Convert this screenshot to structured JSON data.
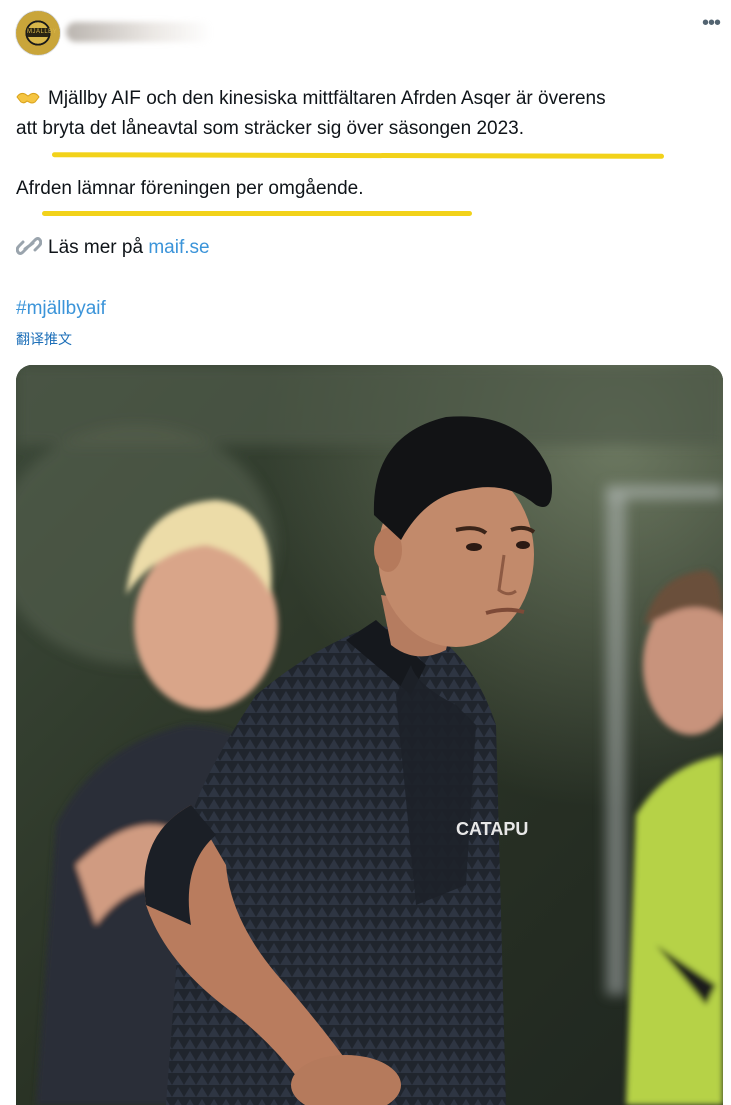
{
  "tweet": {
    "avatar_text": "MJÄLLBY",
    "paragraph1_line1": "Mjällby AIF och den kinesiska mittfältaren Afrden Asqer är överens",
    "paragraph1_line2": "att bryta det låneavtal som sträcker sig över säsongen 2023.",
    "paragraph2": "Afrden lämnar föreningen per omgående.",
    "read_more_prefix": "Läs mer på",
    "read_more_link": "maif.se",
    "hashtag": "#mjällbyaif",
    "translate_label": "翻译推文",
    "more_icon": "more-horizontal-icon",
    "emoji_icon": "handshake-icon",
    "link_icon": "chain-link-icon",
    "jersey_text": "CATAPU"
  },
  "colors": {
    "link": "#3b94d9",
    "highlight": "#f2d21a",
    "text": "#0f1419"
  }
}
